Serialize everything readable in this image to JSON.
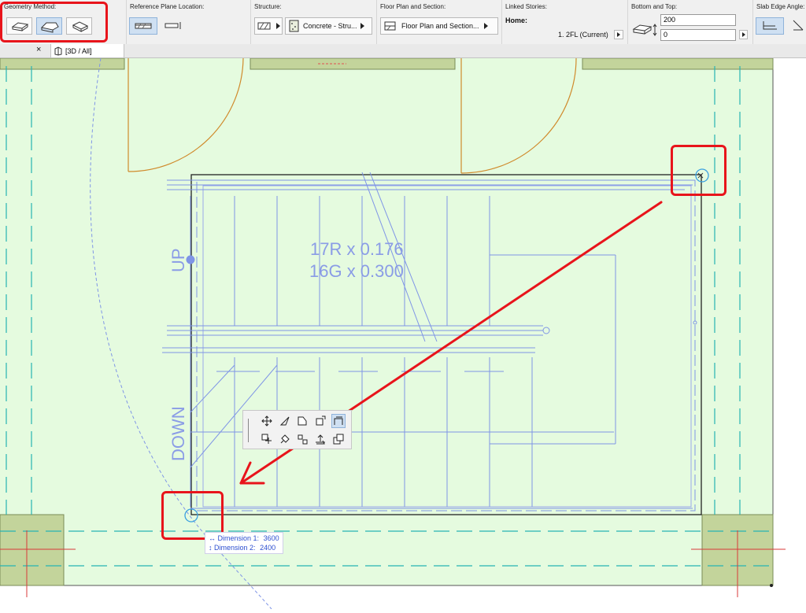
{
  "infobox": {
    "geometry_method_title": "Geometry Method:",
    "ref_plane_title": "Reference Plane Location:",
    "structure_title": "Structure:",
    "structure_value": "Concrete - Stru...",
    "floor_plan_title": "Floor Plan and Section:",
    "floor_plan_value": "Floor Plan and Section...",
    "linked_stories_title": "Linked Stories:",
    "home_label": "Home:",
    "home_value": "1. 2FL (Current)",
    "bottom_top_title": "Bottom and Top:",
    "top_value": "200",
    "bottom_value": "0",
    "slab_edge_title": "Slab Edge Angle:"
  },
  "tabs": {
    "close_glyph": "×",
    "view_label": "[3D / All]"
  },
  "plan": {
    "up_label": "UP",
    "down_label": "DOWN",
    "riser_text": "17R x 0.176",
    "going_text": "16G x 0.300"
  },
  "tracker": {
    "dim1_label": "Dimension 1:",
    "dim1_value": "3600",
    "dim2_label": "Dimension 2:",
    "dim2_value": "2400"
  },
  "colors": {
    "highlight": "#e8141b",
    "plan_line": "#7f95e6",
    "floor_fill": "#e5fbdf",
    "column_fill": "#c3d49b",
    "grid_line": "#27b3b3"
  }
}
